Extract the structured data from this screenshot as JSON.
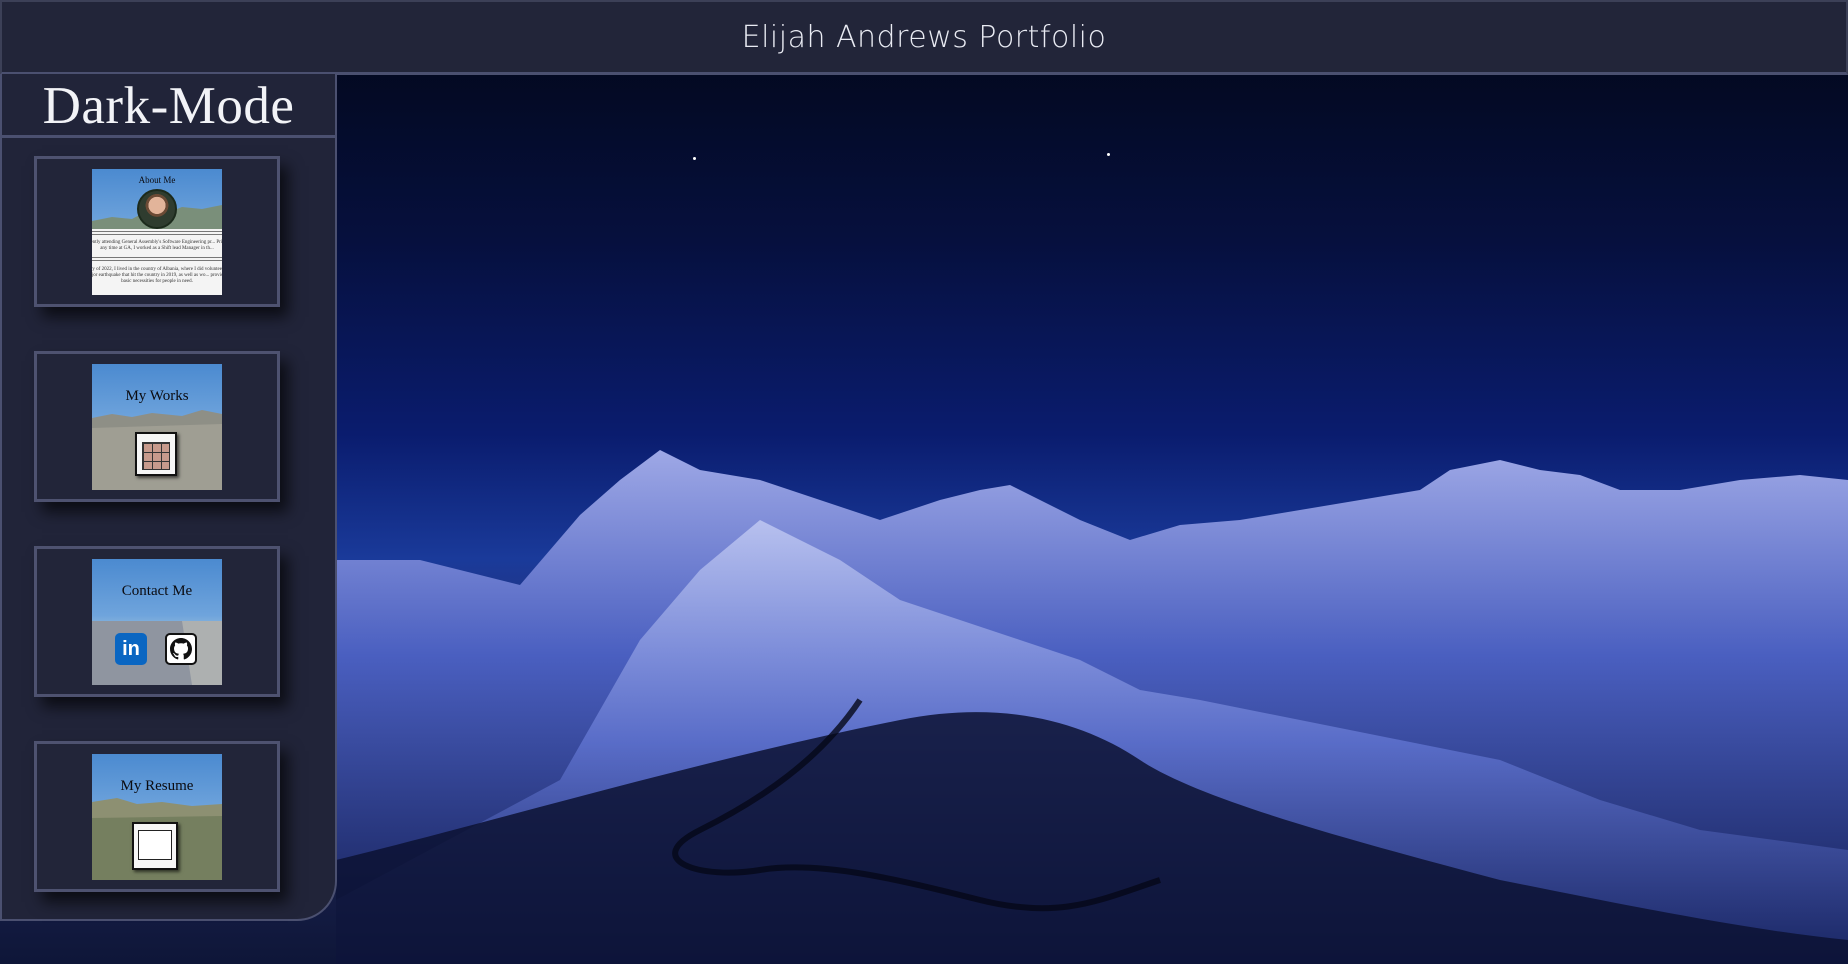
{
  "header": {
    "title": "Elijah Andrews Portfolio"
  },
  "sidebar": {
    "title": "Dark-Mode",
    "cards": [
      {
        "label": "About Me",
        "text_top": "currently attending General Assembly's Software Engineering pr... Prior to any time at GA, I worked as a Shift lead Manager in th...",
        "text_bottom": "...ary of 2022, I lived in the country of Albania, where I did voluntee... a major earthquake that hit the country in 2019, as well as wo... provided basic necessities for people in need."
      },
      {
        "label": "My Works"
      },
      {
        "label": "Contact Me",
        "icons": [
          "linkedin-icon",
          "github-icon"
        ]
      },
      {
        "label": "My Resume"
      }
    ]
  },
  "colors": {
    "panel": "#222539",
    "border": "#4b5070",
    "text": "#e9ebf3",
    "linkedin": "#0a66c2"
  }
}
